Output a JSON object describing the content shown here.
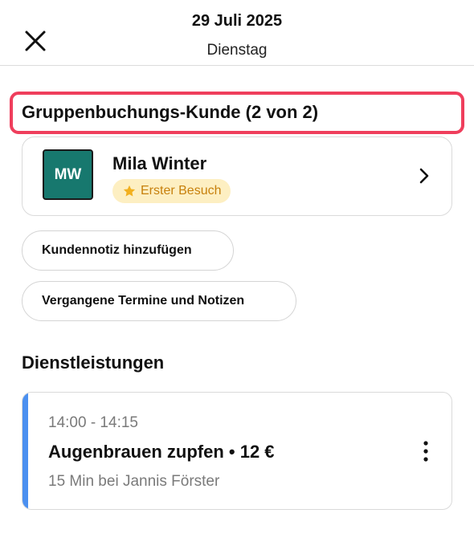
{
  "header": {
    "date": "29 Juli 2025",
    "weekday": "Dienstag"
  },
  "client_section": {
    "title": "Gruppenbuchungs-Kunde (2 von 2)",
    "highlight_color": "#ef3e5c"
  },
  "client": {
    "initials": "MW",
    "name": "Mila Winter",
    "badge": "Erster Besuch",
    "avatar_color": "#17786e"
  },
  "actions": {
    "add_note": "Kundennotiz hinzufügen",
    "past_appointments": "Vergangene Termine und Notizen"
  },
  "services": {
    "title": "Dienstleistungen",
    "items": [
      {
        "time": "14:00 - 14:15",
        "title": "Augenbrauen zupfen • 12 €",
        "subtitle": "15 Min bei Jannis Förster",
        "accent_color": "#4b90f0"
      }
    ]
  },
  "icons": [
    "close-icon",
    "star-icon",
    "chevron-right-icon",
    "kebab-menu-icon"
  ]
}
